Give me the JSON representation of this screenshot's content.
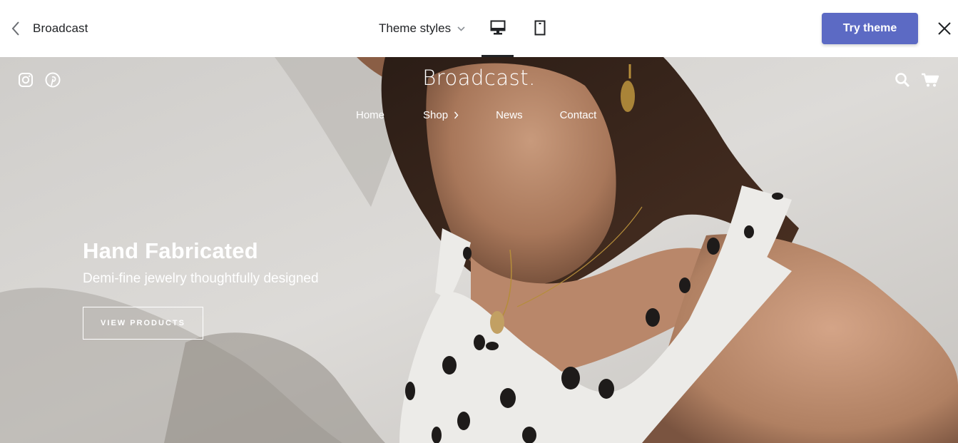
{
  "topbar": {
    "theme_name": "Broadcast",
    "styles_label": "Theme styles",
    "try_label": "Try theme",
    "accent_color": "#5c6ac4",
    "icons": {
      "back": "chevron-left-icon",
      "styles_dropdown": "chevron-down-icon",
      "desktop": "desktop-icon",
      "mobile": "mobile-icon",
      "close": "close-icon"
    },
    "selected_device": "desktop"
  },
  "store": {
    "logo": "Broadcast.",
    "social_icons": [
      "instagram-icon",
      "pinterest-icon"
    ],
    "nav": {
      "home": "Home",
      "shop": "Shop",
      "news": "News",
      "contact": "Contact"
    },
    "header_icons": [
      "search-icon",
      "cart-icon"
    ],
    "hero": {
      "title": "Hand Fabricated",
      "subtitle": "Demi-fine jewelry thoughtfully designed",
      "cta": "VIEW PRODUCTS"
    }
  }
}
